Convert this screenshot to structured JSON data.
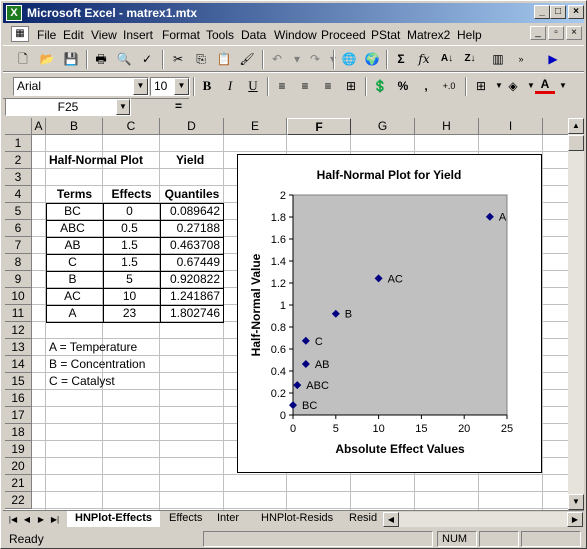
{
  "window": {
    "title": "Microsoft Excel - matrex1.mtx"
  },
  "menu": {
    "items": [
      "File",
      "Edit",
      "View",
      "Insert",
      "Format",
      "Tools",
      "Data",
      "Window",
      "Proceed",
      "PStat",
      "Matrex2",
      "Help"
    ]
  },
  "format_toolbar": {
    "font_name": "Arial",
    "font_size": "10"
  },
  "formula_bar": {
    "name_box": "F25",
    "equals": "="
  },
  "grid": {
    "columns": [
      "A",
      "B",
      "C",
      "D",
      "E",
      "F",
      "G",
      "H",
      "I"
    ],
    "rows": [
      "1",
      "2",
      "3",
      "4",
      "5",
      "6",
      "7",
      "8",
      "9",
      "10",
      "11",
      "12",
      "13",
      "14",
      "15",
      "16",
      "17",
      "18",
      "19",
      "20",
      "21",
      "22"
    ],
    "selected_column": "F"
  },
  "sheet": {
    "b2": "Half-Normal Plot",
    "d2": "Yield",
    "table_headers": [
      "Terms",
      "Effects",
      "Quantiles"
    ],
    "table_rows": [
      [
        "BC",
        "0",
        "0.089642"
      ],
      [
        "ABC",
        "0.5",
        "0.27188"
      ],
      [
        "AB",
        "1.5",
        "0.463708"
      ],
      [
        "C",
        "1.5",
        "0.67449"
      ],
      [
        "B",
        "5",
        "0.920822"
      ],
      [
        "AC",
        "10",
        "1.241867"
      ],
      [
        "A",
        "23",
        "1.802746"
      ]
    ],
    "legend_notes": [
      "A = Temperature",
      "B = Concentration",
      "C = Catalyst"
    ]
  },
  "chart_data": {
    "type": "scatter",
    "title": "Half-Normal Plot  for Yield",
    "xlabel": "Absolute Effect Values",
    "ylabel": "Half-Normal Value",
    "xlim": [
      0,
      25
    ],
    "ylim": [
      0,
      2
    ],
    "xticks": [
      "0",
      "5",
      "10",
      "15",
      "20",
      "25"
    ],
    "yticks": [
      "0",
      "0.2",
      "0.4",
      "0.6",
      "0.8",
      "1",
      "1.2",
      "1.4",
      "1.6",
      "1.8",
      "2"
    ],
    "points": [
      {
        "x": 0,
        "y": 0.089642,
        "label": "BC"
      },
      {
        "x": 0.5,
        "y": 0.27188,
        "label": "ABC"
      },
      {
        "x": 1.5,
        "y": 0.463708,
        "label": "AB"
      },
      {
        "x": 1.5,
        "y": 0.67449,
        "label": "C"
      },
      {
        "x": 5,
        "y": 0.920822,
        "label": "B"
      },
      {
        "x": 10,
        "y": 1.241867,
        "label": "AC"
      },
      {
        "x": 23,
        "y": 1.802746,
        "label": "A"
      }
    ],
    "plot_area_color": "#c0c0c0",
    "marker_color": "#000080",
    "grid": false,
    "legend": false
  },
  "tabs": [
    "HNPlot-Effects",
    "Effects",
    "Inter",
    "HNPlot-Resids",
    "Resid"
  ],
  "active_tab": "HNPlot-Effects",
  "status": {
    "ready": "Ready",
    "num": "NUM"
  }
}
